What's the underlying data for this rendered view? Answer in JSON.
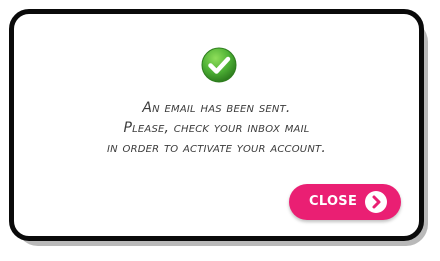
{
  "dialog": {
    "icon": "check-circle-icon",
    "message_lines": [
      "An email has been sent.",
      "Please, check your inbox mail",
      "in order to activate your account."
    ],
    "close_button": {
      "label": "CLOSE",
      "icon": "chevron-right-circle-icon"
    }
  },
  "colors": {
    "accent": "#ea1f73",
    "success": "#4caf34",
    "border": "#0a0a0a",
    "text": "#3c3c3c"
  }
}
